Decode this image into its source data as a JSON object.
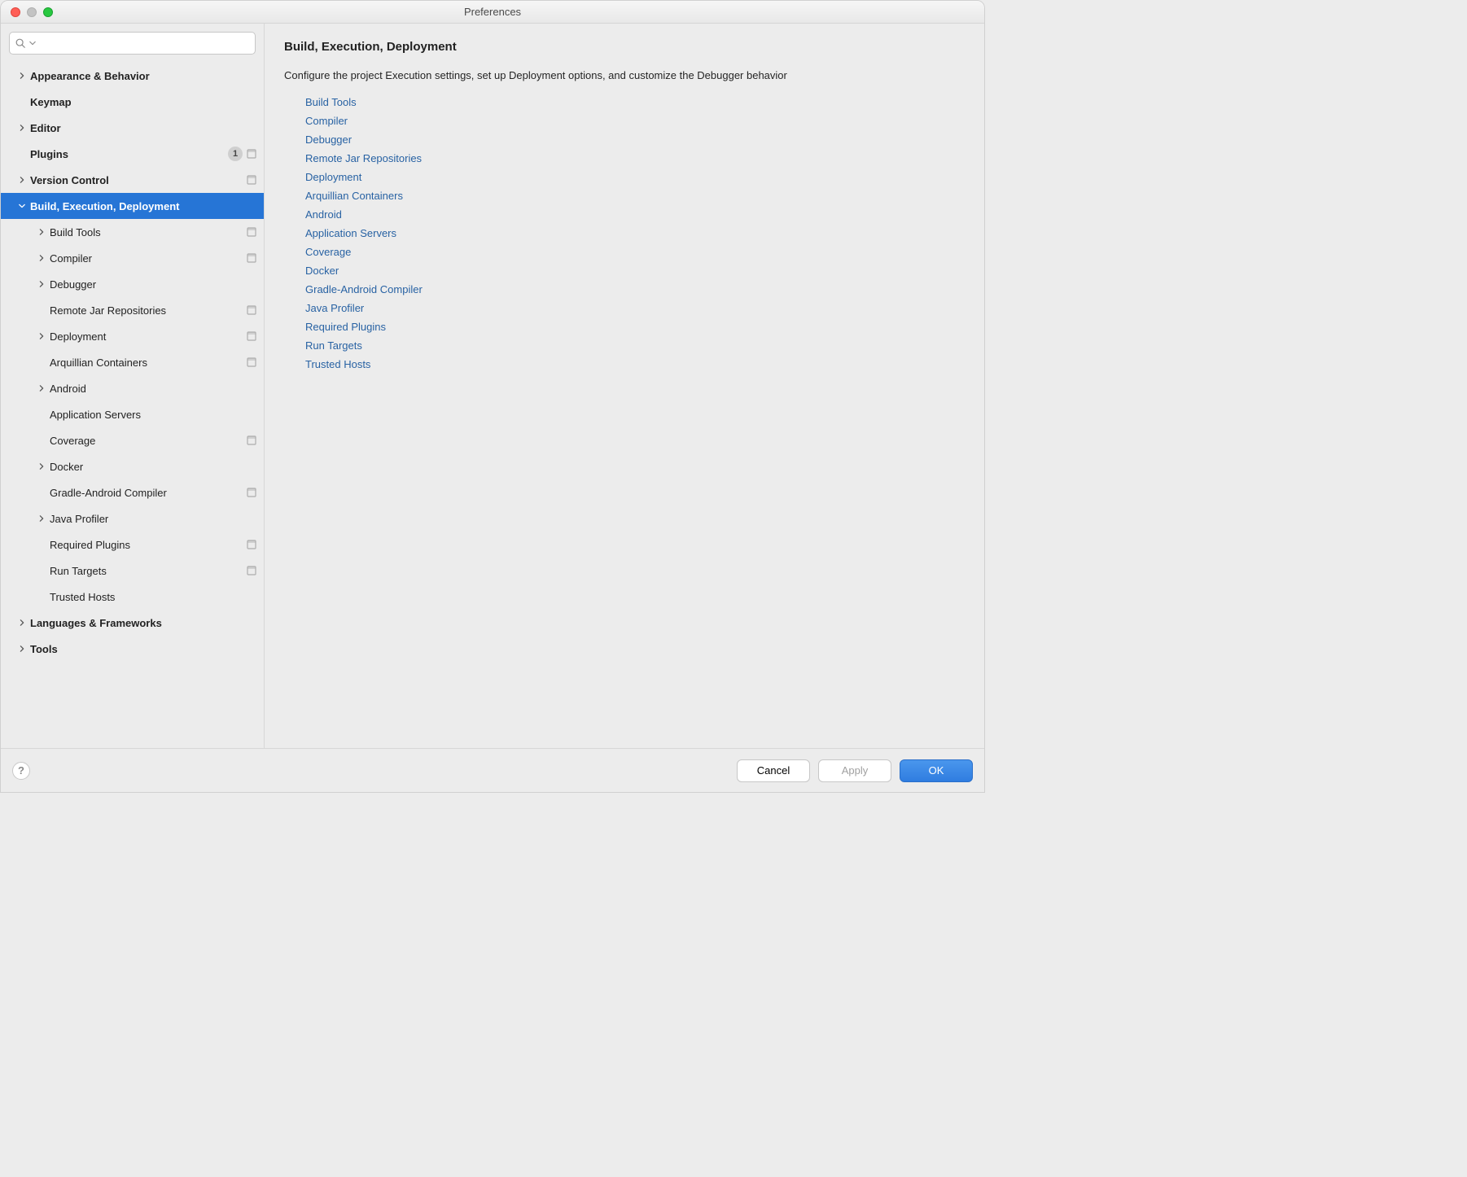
{
  "window": {
    "title": "Preferences"
  },
  "search": {
    "placeholder": ""
  },
  "sidebar": {
    "items": [
      {
        "label": "Appearance & Behavior",
        "level": 0,
        "arrow": "right",
        "bold": true,
        "selected": false,
        "badge": null,
        "proj": false
      },
      {
        "label": "Keymap",
        "level": 0,
        "arrow": "none",
        "bold": true,
        "selected": false,
        "badge": null,
        "proj": false
      },
      {
        "label": "Editor",
        "level": 0,
        "arrow": "right",
        "bold": true,
        "selected": false,
        "badge": null,
        "proj": false
      },
      {
        "label": "Plugins",
        "level": 0,
        "arrow": "none",
        "bold": true,
        "selected": false,
        "badge": "1",
        "proj": true
      },
      {
        "label": "Version Control",
        "level": 0,
        "arrow": "right",
        "bold": true,
        "selected": false,
        "badge": null,
        "proj": true
      },
      {
        "label": "Build, Execution, Deployment",
        "level": 0,
        "arrow": "down",
        "bold": true,
        "selected": true,
        "badge": null,
        "proj": false
      },
      {
        "label": "Build Tools",
        "level": 1,
        "arrow": "right",
        "bold": false,
        "selected": false,
        "badge": null,
        "proj": true
      },
      {
        "label": "Compiler",
        "level": 1,
        "arrow": "right",
        "bold": false,
        "selected": false,
        "badge": null,
        "proj": true
      },
      {
        "label": "Debugger",
        "level": 1,
        "arrow": "right",
        "bold": false,
        "selected": false,
        "badge": null,
        "proj": false
      },
      {
        "label": "Remote Jar Repositories",
        "level": 1,
        "arrow": "none",
        "bold": false,
        "selected": false,
        "badge": null,
        "proj": true
      },
      {
        "label": "Deployment",
        "level": 1,
        "arrow": "right",
        "bold": false,
        "selected": false,
        "badge": null,
        "proj": true
      },
      {
        "label": "Arquillian Containers",
        "level": 1,
        "arrow": "none",
        "bold": false,
        "selected": false,
        "badge": null,
        "proj": true
      },
      {
        "label": "Android",
        "level": 1,
        "arrow": "right",
        "bold": false,
        "selected": false,
        "badge": null,
        "proj": false
      },
      {
        "label": "Application Servers",
        "level": 1,
        "arrow": "none",
        "bold": false,
        "selected": false,
        "badge": null,
        "proj": false
      },
      {
        "label": "Coverage",
        "level": 1,
        "arrow": "none",
        "bold": false,
        "selected": false,
        "badge": null,
        "proj": true
      },
      {
        "label": "Docker",
        "level": 1,
        "arrow": "right",
        "bold": false,
        "selected": false,
        "badge": null,
        "proj": false
      },
      {
        "label": "Gradle-Android Compiler",
        "level": 1,
        "arrow": "none",
        "bold": false,
        "selected": false,
        "badge": null,
        "proj": true
      },
      {
        "label": "Java Profiler",
        "level": 1,
        "arrow": "right",
        "bold": false,
        "selected": false,
        "badge": null,
        "proj": false
      },
      {
        "label": "Required Plugins",
        "level": 1,
        "arrow": "none",
        "bold": false,
        "selected": false,
        "badge": null,
        "proj": true
      },
      {
        "label": "Run Targets",
        "level": 1,
        "arrow": "none",
        "bold": false,
        "selected": false,
        "badge": null,
        "proj": true
      },
      {
        "label": "Trusted Hosts",
        "level": 1,
        "arrow": "none",
        "bold": false,
        "selected": false,
        "badge": null,
        "proj": false
      },
      {
        "label": "Languages & Frameworks",
        "level": 0,
        "arrow": "right",
        "bold": true,
        "selected": false,
        "badge": null,
        "proj": false
      },
      {
        "label": "Tools",
        "level": 0,
        "arrow": "right",
        "bold": true,
        "selected": false,
        "badge": null,
        "proj": false
      }
    ]
  },
  "main": {
    "title": "Build, Execution, Deployment",
    "blurb": "Configure the project Execution settings, set up Deployment options, and customize the Debugger behavior",
    "links": [
      "Build Tools",
      "Compiler",
      "Debugger",
      "Remote Jar Repositories",
      "Deployment",
      "Arquillian Containers",
      "Android",
      "Application Servers",
      "Coverage",
      "Docker",
      "Gradle-Android Compiler",
      "Java Profiler",
      "Required Plugins",
      "Run Targets",
      "Trusted Hosts"
    ]
  },
  "footer": {
    "help": "?",
    "cancel": "Cancel",
    "apply": "Apply",
    "ok": "OK"
  }
}
